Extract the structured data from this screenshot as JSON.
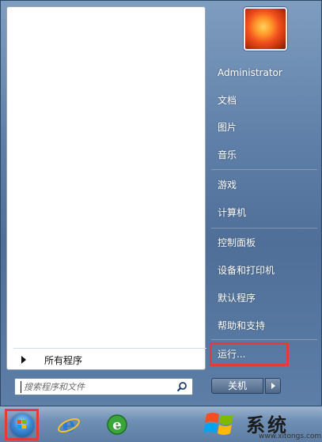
{
  "start_menu": {
    "all_programs": "所有程序",
    "search_placeholder": "搜索程序和文件",
    "right_items": {
      "user": "Administrator",
      "documents": "文档",
      "pictures": "图片",
      "music": "音乐",
      "games": "游戏",
      "computer": "计算机",
      "control_panel": "控制面板",
      "devices_printers": "设备和打印机",
      "default_programs": "默认程序",
      "help_support": "帮助和支持",
      "run": "运行..."
    },
    "shutdown": "关机"
  },
  "watermark": {
    "text": "系统",
    "url": "www.xitongs.com"
  },
  "colors": {
    "highlight": "#e43b3b",
    "menu_blue": "#5f7fa8"
  }
}
